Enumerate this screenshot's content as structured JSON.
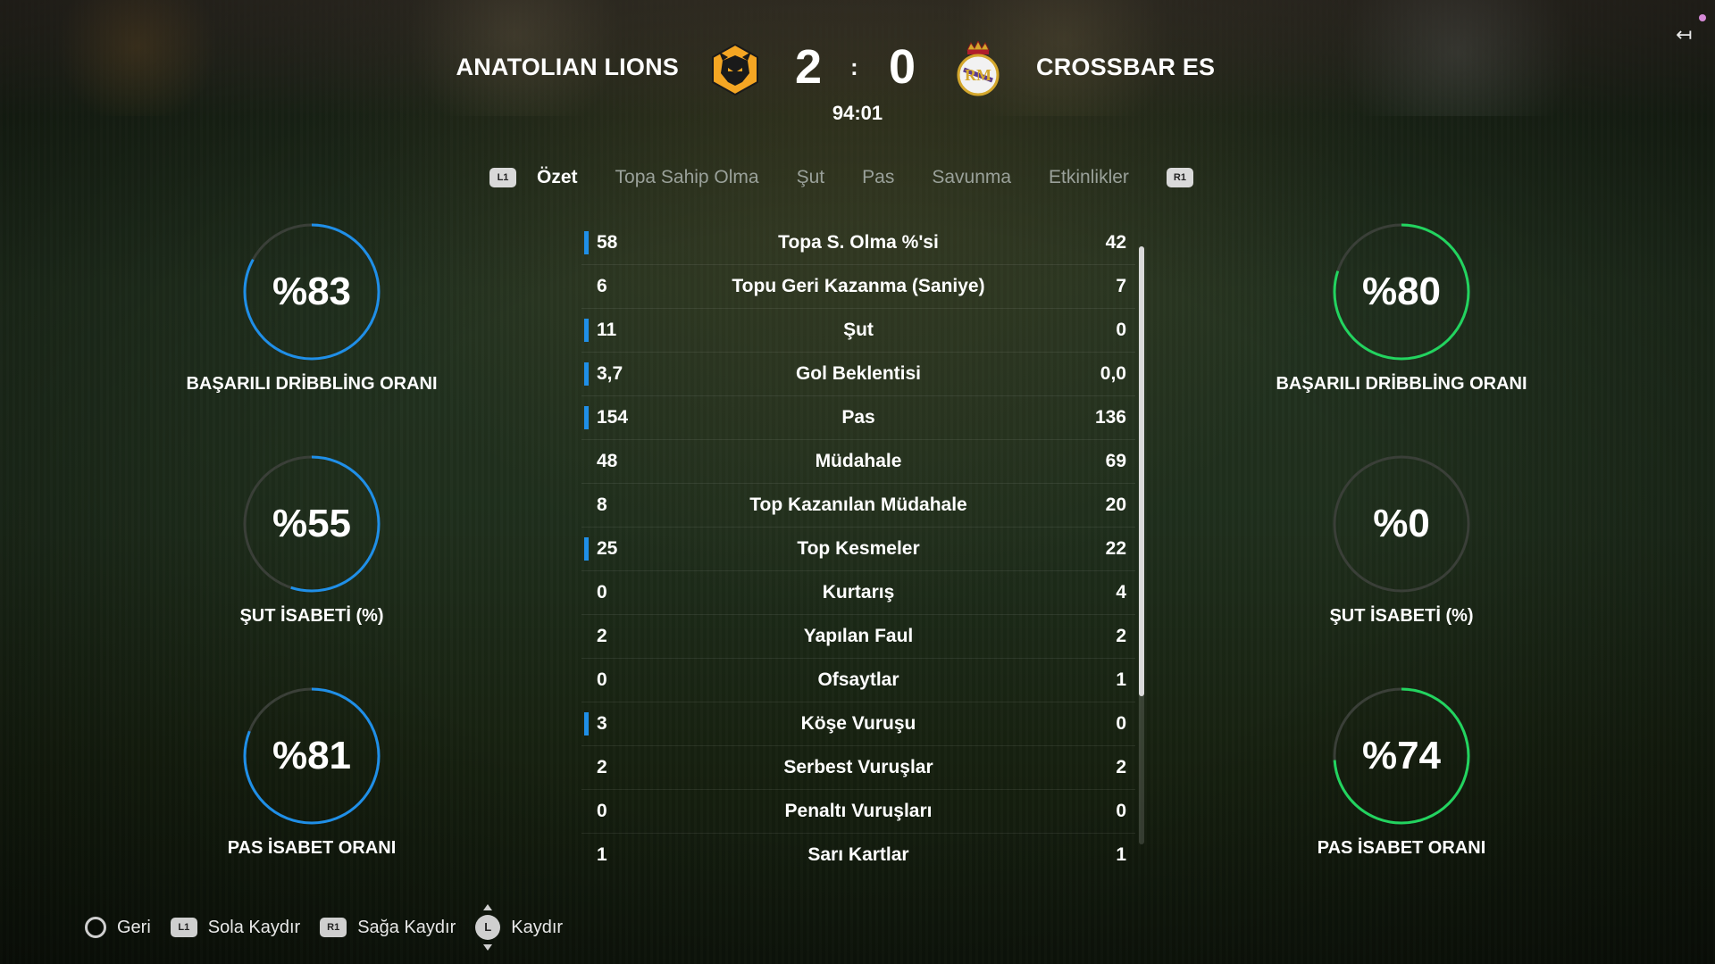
{
  "header": {
    "home_team": "ANATOLIAN LIONS",
    "away_team": "CROSSBAR ES",
    "home_score": "2",
    "score_separator": ":",
    "away_score": "0",
    "match_clock": "94:01",
    "home_crest_icon": "wolf-head-crest-icon",
    "away_crest_icon": "crowned-club-crest-icon",
    "exit_icon": "exit-arrow-icon"
  },
  "tabs": {
    "left_shoulder": "L1",
    "right_shoulder": "R1",
    "items": [
      {
        "label": "Özet",
        "active": true
      },
      {
        "label": "Topa Sahip Olma",
        "active": false
      },
      {
        "label": "Şut",
        "active": false
      },
      {
        "label": "Pas",
        "active": false
      },
      {
        "label": "Savunma",
        "active": false
      },
      {
        "label": "Etkinlikler",
        "active": false
      }
    ]
  },
  "home_rings": [
    {
      "value": "%83",
      "percent": 83,
      "label": "BAŞARILI DRİBBLİNG ORANI"
    },
    {
      "value": "%55",
      "percent": 55,
      "label": "ŞUT İSABETİ (%)"
    },
    {
      "value": "%81",
      "percent": 81,
      "label": "PAS İSABET ORANI"
    }
  ],
  "away_rings": [
    {
      "value": "%80",
      "percent": 80,
      "label": "BAŞARILI DRİBBLİNG ORANI"
    },
    {
      "value": "%0",
      "percent": 0,
      "label": "ŞUT İSABETİ (%)"
    },
    {
      "value": "%74",
      "percent": 74,
      "label": "PAS İSABET ORANI"
    }
  ],
  "colors": {
    "home_accent": "#1f8fe8",
    "away_accent": "#22d45f",
    "ring_track": "#3a3f38"
  },
  "stats": [
    {
      "home": "58",
      "label": "Topa S. Olma %'si",
      "away": "42",
      "leader": "home"
    },
    {
      "home": "6",
      "label": "Topu Geri Kazanma (Saniye)",
      "away": "7",
      "leader": "away"
    },
    {
      "home": "11",
      "label": "Şut",
      "away": "0",
      "leader": "home"
    },
    {
      "home": "3,7",
      "label": "Gol Beklentisi",
      "away": "0,0",
      "leader": "home"
    },
    {
      "home": "154",
      "label": "Pas",
      "away": "136",
      "leader": "home"
    },
    {
      "home": "48",
      "label": "Müdahale",
      "away": "69",
      "leader": "away"
    },
    {
      "home": "8",
      "label": "Top Kazanılan Müdahale",
      "away": "20",
      "leader": "away"
    },
    {
      "home": "25",
      "label": "Top Kesmeler",
      "away": "22",
      "leader": "home"
    },
    {
      "home": "0",
      "label": "Kurtarış",
      "away": "4",
      "leader": "away"
    },
    {
      "home": "2",
      "label": "Yapılan Faul",
      "away": "2",
      "leader": "none"
    },
    {
      "home": "0",
      "label": "Ofsaytlar",
      "away": "1",
      "leader": "away"
    },
    {
      "home": "3",
      "label": "Köşe Vuruşu",
      "away": "0",
      "leader": "home"
    },
    {
      "home": "2",
      "label": "Serbest Vuruşlar",
      "away": "2",
      "leader": "none"
    },
    {
      "home": "0",
      "label": "Penaltı Vuruşları",
      "away": "0",
      "leader": "none"
    },
    {
      "home": "1",
      "label": "Sarı Kartlar",
      "away": "1",
      "leader": "none"
    }
  ],
  "footer": {
    "back": {
      "button": "circle-button-icon",
      "label": "Geri"
    },
    "scroll_left": {
      "button": "L1",
      "label": "Sola Kaydır"
    },
    "scroll_right": {
      "button": "R1",
      "label": "Sağa Kaydır"
    },
    "scroll": {
      "button": "L",
      "label": "Kaydır"
    }
  }
}
